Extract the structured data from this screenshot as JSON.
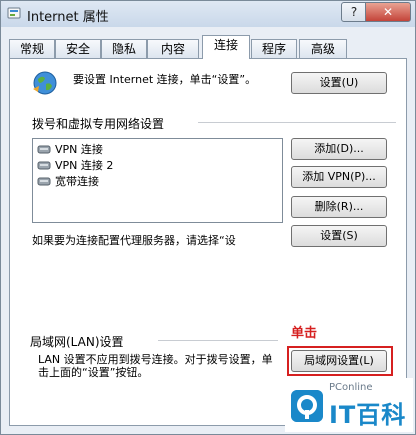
{
  "window": {
    "title": "Internet 属性",
    "help_label": "?",
    "close_label": "✕"
  },
  "tabs": [
    {
      "label": "常规"
    },
    {
      "label": "安全"
    },
    {
      "label": "隐私"
    },
    {
      "label": "内容"
    },
    {
      "label": "连接",
      "active": true
    },
    {
      "label": "程序"
    },
    {
      "label": "高级"
    }
  ],
  "setup": {
    "text": "要设置 Internet 连接，单击“设置”。",
    "button": "设置(U)"
  },
  "dialup": {
    "section_title": "拨号和虚拟专用网络设置",
    "connections": [
      {
        "label": "VPN 连接"
      },
      {
        "label": "VPN 连接 2"
      },
      {
        "label": "宽带连接"
      }
    ],
    "add_button": "添加(D)...",
    "add_vpn_button": "添加 VPN(P)...",
    "remove_button": "删除(R)...",
    "proxy_text": "如果要为连接配置代理服务器，请选择“设",
    "settings_button": "设置(S)"
  },
  "lan": {
    "section_title": "局域网(LAN)设置",
    "text": "LAN 设置不应用到拨号连接。对于拨号设置，单击上面的“设置”按钮。",
    "button": "局域网设置(L)",
    "annotation": "单击"
  },
  "watermark": {
    "top_text": "PConline",
    "brand": "IT百科"
  },
  "colors": {
    "annotation": "#d62020",
    "brand": "#1a88c9"
  }
}
